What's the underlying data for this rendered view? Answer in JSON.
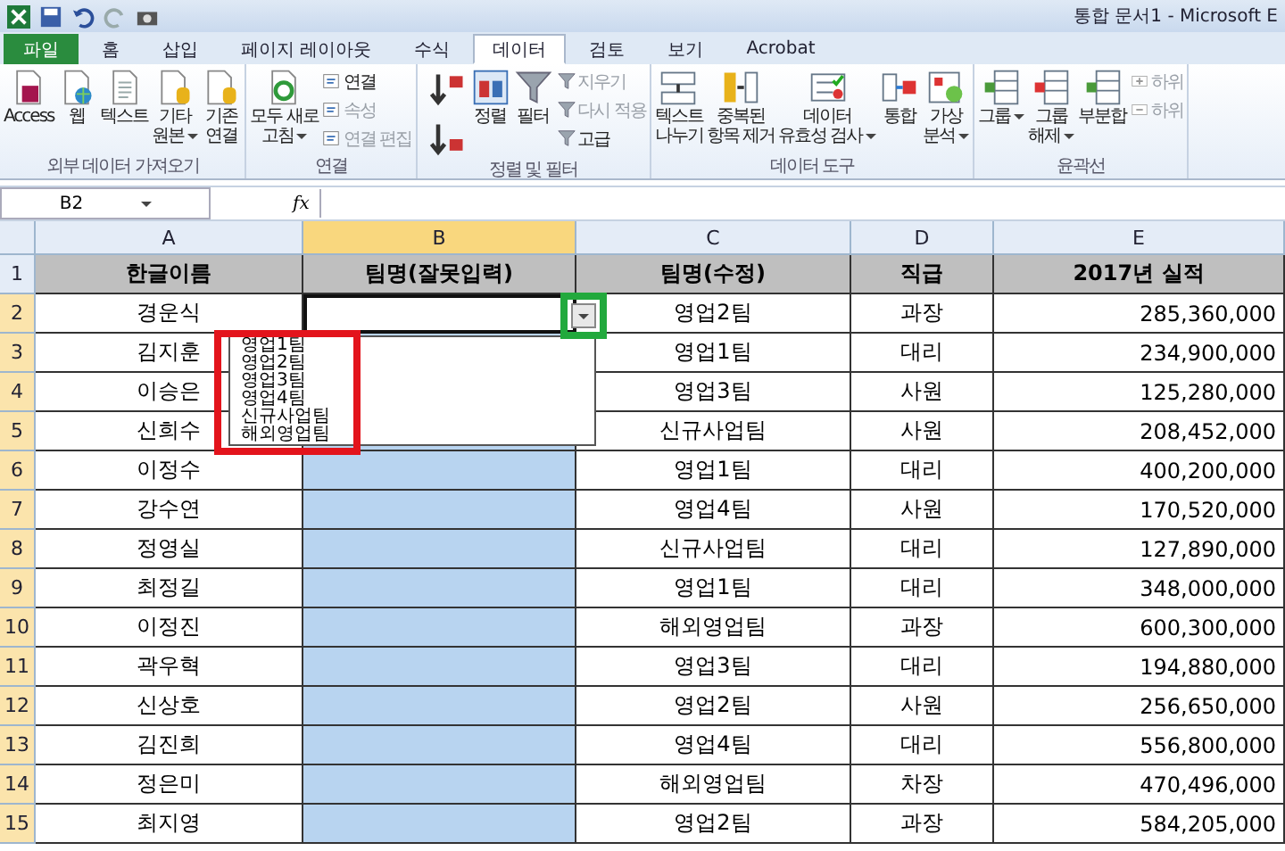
{
  "window": {
    "title": "통합 문서1 - Microsoft E"
  },
  "tabs": [
    {
      "label": "파일",
      "kind": "file",
      "selected": false
    },
    {
      "label": "홈",
      "kind": "tab",
      "selected": false
    },
    {
      "label": "삽입",
      "kind": "tab",
      "selected": false
    },
    {
      "label": "페이지 레이아웃",
      "kind": "tab",
      "selected": false
    },
    {
      "label": "수식",
      "kind": "tab",
      "selected": false
    },
    {
      "label": "데이터",
      "kind": "tab",
      "selected": true
    },
    {
      "label": "검토",
      "kind": "tab",
      "selected": false
    },
    {
      "label": "보기",
      "kind": "tab",
      "selected": false
    },
    {
      "label": "Acrobat",
      "kind": "tab",
      "selected": false
    }
  ],
  "ribbon": [
    {
      "label": "외부 데이터 가져오기",
      "items": [
        {
          "kind": "large",
          "label": "Access",
          "dropdown": false
        },
        {
          "kind": "large",
          "label": "웹",
          "dropdown": false
        },
        {
          "kind": "large",
          "label": "텍스트",
          "dropdown": false
        },
        {
          "kind": "large",
          "label": "기타\n원본",
          "dropdown": true
        },
        {
          "kind": "large",
          "label": "기존\n연결",
          "dropdown": false
        }
      ]
    },
    {
      "label": "연결",
      "items": [
        {
          "kind": "large",
          "label": "모두 새로\n고침",
          "dropdown": true
        },
        {
          "kind": "stack",
          "items": [
            {
              "label": "연결",
              "disabled": false
            },
            {
              "label": "속성",
              "disabled": true
            },
            {
              "label": "연결 편집",
              "disabled": true
            }
          ]
        }
      ]
    },
    {
      "label": "정렬 및 필터",
      "items": [
        {
          "kind": "icons",
          "items": [
            {
              "kind": "sort-ascending"
            },
            {
              "kind": "sort-descending"
            }
          ]
        },
        {
          "kind": "large",
          "label": "정렬",
          "dropdown": false
        },
        {
          "kind": "large",
          "label": "필터",
          "dropdown": false
        },
        {
          "kind": "stack",
          "items": [
            {
              "label": "지우기",
              "disabled": true
            },
            {
              "label": "다시 적용",
              "disabled": true
            },
            {
              "label": "고급",
              "disabled": false
            }
          ]
        }
      ]
    },
    {
      "label": "데이터 도구",
      "items": [
        {
          "kind": "large",
          "label": "텍스트\n나누기",
          "dropdown": false
        },
        {
          "kind": "large",
          "label": "중복된\n항목 제거",
          "dropdown": false
        },
        {
          "kind": "large",
          "label": "데이터\n유효성 검사",
          "dropdown": true
        },
        {
          "kind": "large",
          "label": "통합",
          "dropdown": false
        },
        {
          "kind": "large",
          "label": "가상\n분석",
          "dropdown": true
        }
      ]
    },
    {
      "label": "윤곽선",
      "items": [
        {
          "kind": "large",
          "label": "그룹",
          "dropdown": true
        },
        {
          "kind": "large",
          "label": "그룹\n해제",
          "dropdown": true
        },
        {
          "kind": "large",
          "label": "부분합",
          "dropdown": false
        },
        {
          "kind": "stack",
          "items": [
            {
              "label": "하위",
              "disabled": true
            },
            {
              "label": "하위",
              "disabled": true
            }
          ]
        }
      ]
    }
  ],
  "formula_bar": {
    "name_box": "B2",
    "fx": "fx"
  },
  "columns": [
    {
      "label": "A",
      "selected": false
    },
    {
      "label": "B",
      "selected": true
    },
    {
      "label": "C",
      "selected": false
    },
    {
      "label": "D",
      "selected": false
    },
    {
      "label": "E",
      "selected": false
    }
  ],
  "header_row": {
    "number": "1",
    "selected": false,
    "cells": [
      "한글이름",
      "팀명(잘못입력)",
      "팀명(수정)",
      "직급",
      "2017년 실적"
    ]
  },
  "rows": [
    {
      "number": "2",
      "selected": true,
      "active": true,
      "name": "경운식",
      "team": "영업2팀",
      "rank": "과장",
      "sales": "285,360,000"
    },
    {
      "number": "3",
      "selected": true,
      "active": false,
      "name": "김지훈",
      "team": "영업1팀",
      "rank": "대리",
      "sales": "234,900,000"
    },
    {
      "number": "4",
      "selected": true,
      "active": false,
      "name": "이승은",
      "team": "영업3팀",
      "rank": "사원",
      "sales": "125,280,000"
    },
    {
      "number": "5",
      "selected": true,
      "active": false,
      "name": "신희수",
      "team": "신규사업팀",
      "rank": "사원",
      "sales": "208,452,000"
    },
    {
      "number": "6",
      "selected": true,
      "active": false,
      "name": "이정수",
      "team": "영업1팀",
      "rank": "대리",
      "sales": "400,200,000"
    },
    {
      "number": "7",
      "selected": true,
      "active": false,
      "name": "강수연",
      "team": "영업4팀",
      "rank": "사원",
      "sales": "170,520,000"
    },
    {
      "number": "8",
      "selected": true,
      "active": false,
      "name": "정영실",
      "team": "신규사업팀",
      "rank": "대리",
      "sales": "127,890,000"
    },
    {
      "number": "9",
      "selected": true,
      "active": false,
      "name": "최정길",
      "team": "영업1팀",
      "rank": "대리",
      "sales": "348,000,000"
    },
    {
      "number": "10",
      "selected": true,
      "active": false,
      "name": "이정진",
      "team": "해외영업팀",
      "rank": "과장",
      "sales": "600,300,000"
    },
    {
      "number": "11",
      "selected": true,
      "active": false,
      "name": "곽우혁",
      "team": "영업3팀",
      "rank": "대리",
      "sales": "194,880,000"
    },
    {
      "number": "12",
      "selected": true,
      "active": false,
      "name": "신상호",
      "team": "영업2팀",
      "rank": "사원",
      "sales": "256,650,000"
    },
    {
      "number": "13",
      "selected": true,
      "active": false,
      "name": "김진희",
      "team": "영업4팀",
      "rank": "대리",
      "sales": "556,800,000"
    },
    {
      "number": "14",
      "selected": true,
      "active": false,
      "name": "정은미",
      "team": "해외영업팀",
      "rank": "차장",
      "sales": "470,496,000"
    },
    {
      "number": "15",
      "selected": true,
      "active": false,
      "name": "최지영",
      "team": "영업2팀",
      "rank": "과장",
      "sales": "584,205,000"
    }
  ],
  "validation_list": {
    "items": [
      "영업1팀",
      "영업2팀",
      "영업3팀",
      "영업4팀",
      "신규사업팀",
      "해외영업팀"
    ]
  },
  "annotations": [
    {
      "kind": "list-frame",
      "color": "#e3141c"
    },
    {
      "kind": "button-frame",
      "color": "#22a93d"
    }
  ]
}
